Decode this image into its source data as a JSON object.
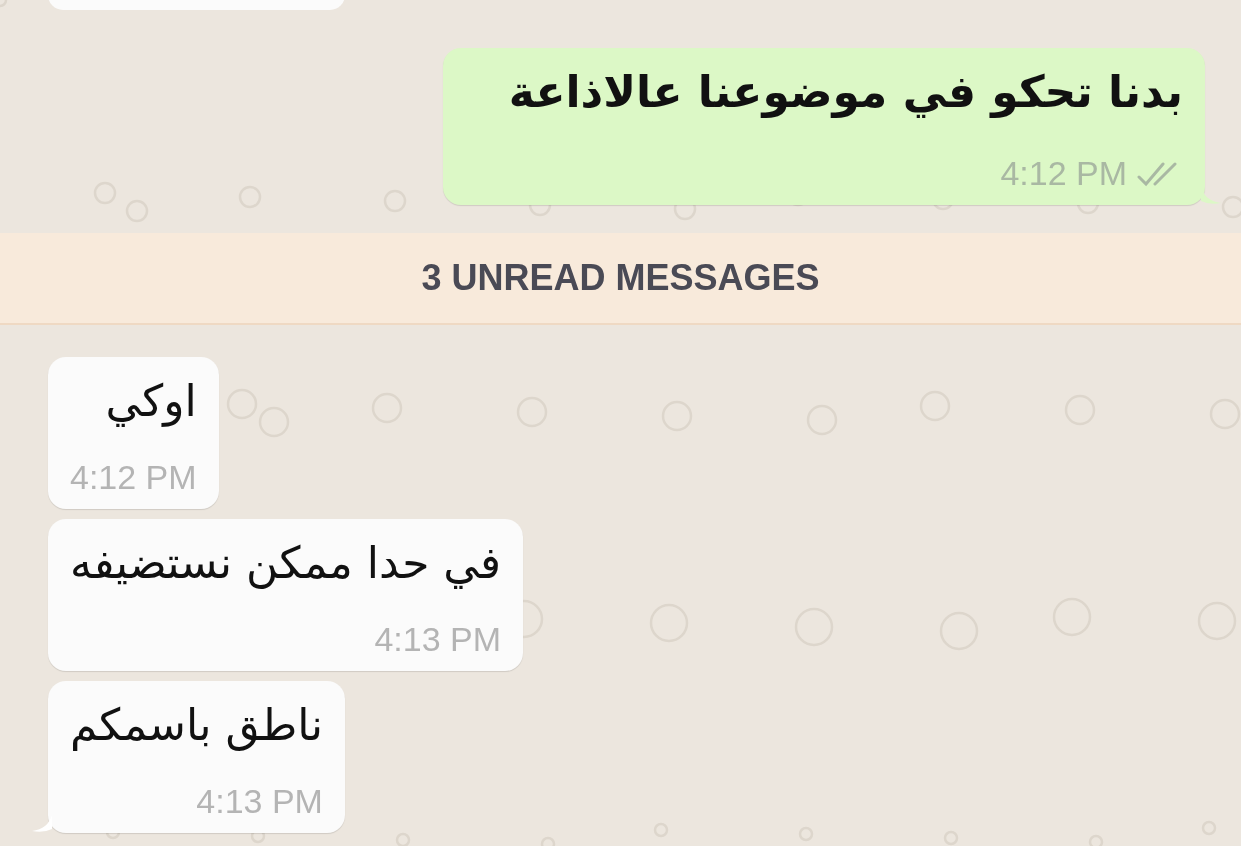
{
  "messages": [
    {
      "outgoing": true,
      "text": "بدنا تحكو في موضوعنا عالاذاعة",
      "time": "4:12 PM",
      "read": false,
      "tail": true
    },
    {
      "kind": "divider",
      "label": "3 UNREAD MESSAGES"
    },
    {
      "outgoing": false,
      "text": "اوكي",
      "time": "4:12 PM",
      "tail": false
    },
    {
      "outgoing": false,
      "text": "في حدا ممكن نستضيفه",
      "time": "4:13 PM",
      "tail": false
    },
    {
      "outgoing": false,
      "text": "ناطق باسمكم",
      "time": "4:13 PM",
      "tail": true
    }
  ]
}
